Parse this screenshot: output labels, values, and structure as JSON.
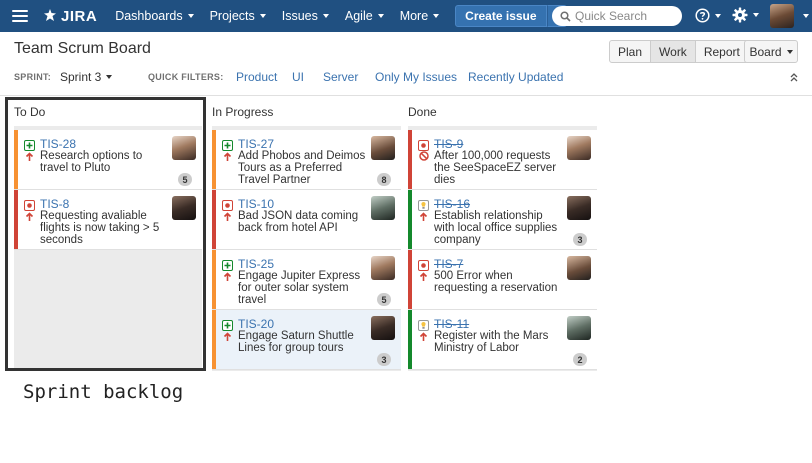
{
  "nav": {
    "logo_text": "JIRA",
    "items": [
      "Dashboards",
      "Projects",
      "Issues",
      "Agile",
      "More"
    ],
    "create_label": "Create issue",
    "search_placeholder": "Quick Search"
  },
  "board": {
    "title": "Team Scrum Board",
    "views": [
      "Plan",
      "Work",
      "Report"
    ],
    "active_view": "Work",
    "board_menu": "Board",
    "sprint_label": "SPRINT:",
    "sprint_value": "Sprint 3",
    "quick_filters_label": "QUICK FILTERS:",
    "quick_filters": [
      "Product",
      "UI",
      "Server",
      "Only My Issues",
      "Recently Updated"
    ]
  },
  "columns": [
    {
      "name": "To Do",
      "cards": [
        {
          "key": "TIS-28",
          "type": "story",
          "status_color": "#f79232",
          "summary": "Research options to travel to Pluto",
          "estimate": "5",
          "priority": "up-arrow",
          "done": false
        },
        {
          "key": "TIS-8",
          "type": "bug",
          "status_color": "#d04437",
          "summary": "Requesting avaliable flights is now taking > 5 seconds",
          "estimate": "",
          "priority": "up-arrow",
          "done": false
        }
      ]
    },
    {
      "name": "In Progress",
      "cards": [
        {
          "key": "TIS-27",
          "type": "story",
          "status_color": "#f79232",
          "summary": "Add Phobos and Deimos Tours as a Preferred Travel Partner",
          "estimate": "8",
          "priority": "up-arrow",
          "done": false
        },
        {
          "key": "TIS-10",
          "type": "bug",
          "status_color": "#d04437",
          "summary": "Bad JSON data coming back from hotel API",
          "estimate": "",
          "priority": "up-arrow",
          "done": false
        },
        {
          "key": "TIS-25",
          "type": "story",
          "status_color": "#f79232",
          "summary": "Engage Jupiter Express for outer solar system travel",
          "estimate": "5",
          "priority": "up-arrow",
          "done": false
        },
        {
          "key": "TIS-20",
          "type": "story",
          "status_color": "#f79232",
          "summary": "Engage Saturn Shuttle Lines for group tours",
          "estimate": "3",
          "priority": "up-arrow",
          "done": false,
          "selected": true
        }
      ]
    },
    {
      "name": "Done",
      "cards": [
        {
          "key": "TIS-9",
          "type": "bug",
          "status_color": "#d04437",
          "summary": "After 100,000 requests the SeeSpaceEZ server dies",
          "estimate": "",
          "priority": "blocker",
          "done": true
        },
        {
          "key": "TIS-16",
          "type": "improvement",
          "status_color": "#14892c",
          "summary": "Establish relationship with local office supplies company",
          "estimate": "3",
          "priority": "up-arrow",
          "done": true
        },
        {
          "key": "TIS-7",
          "type": "bug",
          "status_color": "#d04437",
          "summary": "500 Error when requesting a reservation",
          "estimate": "",
          "priority": "up-arrow",
          "done": true
        },
        {
          "key": "TIS-11",
          "type": "improvement",
          "status_color": "#14892c",
          "summary": "Register with the Mars Ministry of Labor",
          "estimate": "2",
          "priority": "up-arrow",
          "done": true
        }
      ]
    }
  ],
  "annotation": "Sprint backlog"
}
